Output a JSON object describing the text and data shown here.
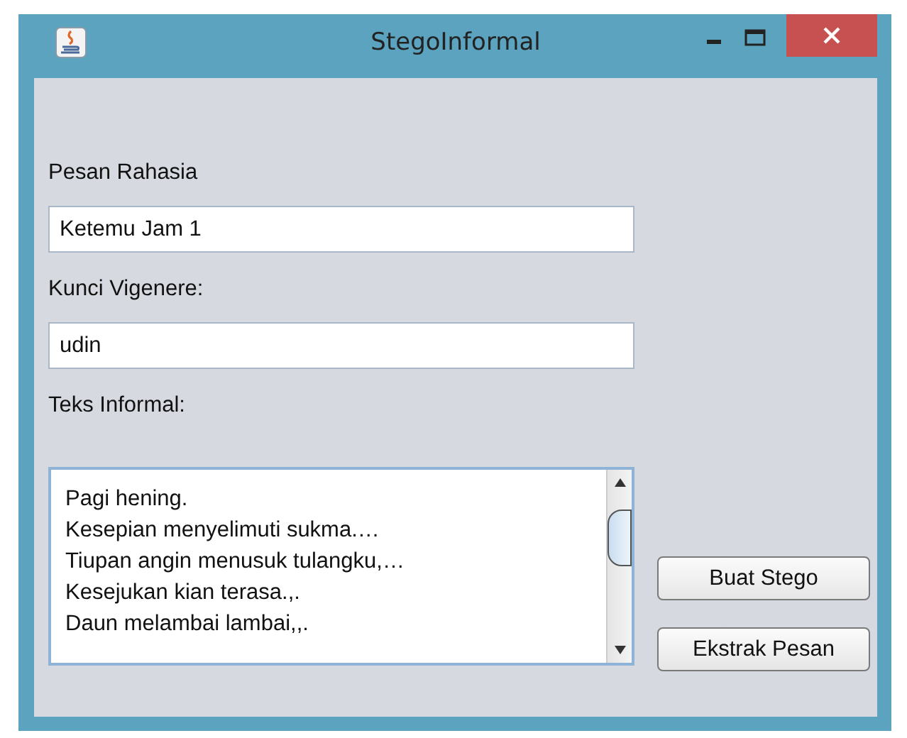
{
  "window": {
    "title": "StegoInformal"
  },
  "fields": [
    {
      "label": "Pesan Rahasia",
      "value": "Ketemu Jam 1"
    },
    {
      "label": "Kunci Vigenere:",
      "value": "udin"
    }
  ],
  "text_area": {
    "label": "Teks Informal:",
    "lines": [
      "Pagi hening.",
      "Kesepian menyelimuti sukma.…",
      "Tiupan angin menusuk tulangku,…",
      "Kesejukan kian terasa.,.",
      "Daun melambai lambai,,."
    ]
  },
  "buttons": [
    "Buat Stego",
    "Ekstrak Pesan"
  ]
}
